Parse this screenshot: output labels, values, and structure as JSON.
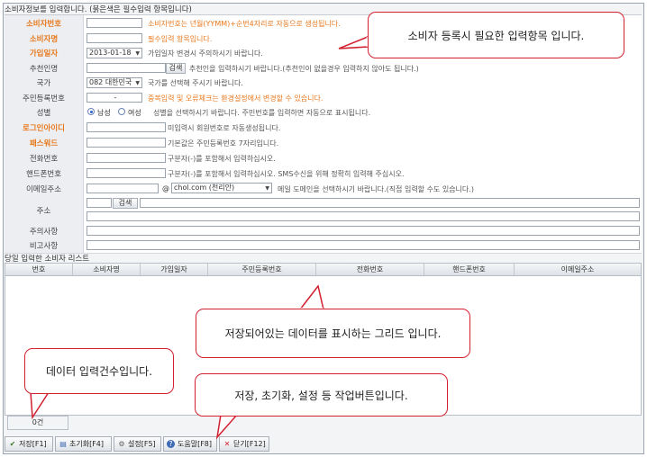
{
  "form": {
    "section_title": "소비자정보를 입력합니다. (붉은색은 필수입력 항목입니다)",
    "rows": {
      "consumer_no": {
        "label": "소비자번호",
        "hint": "소비자번호는 년월(YYMM)+순번4자리로 자동으로 생성됩니다."
      },
      "consumer_name": {
        "label": "소비자명",
        "hint": "필수입력 항목입니다."
      },
      "join_date": {
        "label": "가입일자",
        "value": "2013-01-18",
        "hint": "가입일자 변경시 주의하시기 바랍니다."
      },
      "referrer": {
        "label": "추천인명",
        "button": "검색",
        "hint": "추천인을 입력하시기 바랍니다.(추천인이 없을경우 입력하지 않아도 됩니다.)"
      },
      "country": {
        "label": "국가",
        "value": "082 대한민국",
        "hint": "국가를 선택해 주시기 바랍니다."
      },
      "resident_no": {
        "label": "주민등록번호",
        "dash": "-",
        "hint": "중복입력 및 오류체크는 환경설정에서 변경할 수 있습니다."
      },
      "gender": {
        "label": "성별",
        "male": "남성",
        "female": "여성",
        "hint": "성별을 선택하시기 바랍니다. 주민번호를 입력하면 자동으로 표시됩니다."
      },
      "login_id": {
        "label": "로그인아이디",
        "hint": "미입력시 회원번호로 자동생성됩니다."
      },
      "password": {
        "label": "패스워드",
        "hint": "기본값은 주민등록번호 7자리입니다."
      },
      "phone": {
        "label": "전화번호",
        "hint": "구분자(-)를 포함해서 입력하십시오."
      },
      "mobile": {
        "label": "핸드폰번호",
        "hint": "구분자(-)를 포함해서 입력하십시오. SMS수신을 위해 정확히 입력해 주십시오."
      },
      "email": {
        "label": "이메일주소",
        "at": "@",
        "domain": "chol.com (천리안)",
        "hint": "메일 도메인을 선택하시기 바랍니다.(직접 입력할 수도 있습니다.)"
      },
      "address": {
        "label": "주소",
        "button": "검색"
      },
      "notes": {
        "label": "주의사항"
      },
      "remarks": {
        "label": "비고사항"
      }
    }
  },
  "grid": {
    "title": "당일 입력한 소비자 리스트",
    "columns": [
      "번호",
      "소비자명",
      "가입일자",
      "주민등록번호",
      "전화번호",
      "핸드폰번호",
      "이메일주소"
    ],
    "count": "0건"
  },
  "toolbar": {
    "save": "저장[F1]",
    "reset": "초기화[F4]",
    "settings": "설정[F5]",
    "help": "도움말[F8]",
    "close": "닫기[F12]"
  },
  "callouts": {
    "input_items": "소비자 등록시 필요한 입력항목 입니다.",
    "grid": "저장되어있는 데이터를 표시하는 그리드 입니다.",
    "count": "데이터 입력건수입니다.",
    "buttons": "저장, 초기화, 설정 등 작업버튼입니다."
  },
  "colors": {
    "required": "#e8791e",
    "callout_border": "#d2202f"
  }
}
